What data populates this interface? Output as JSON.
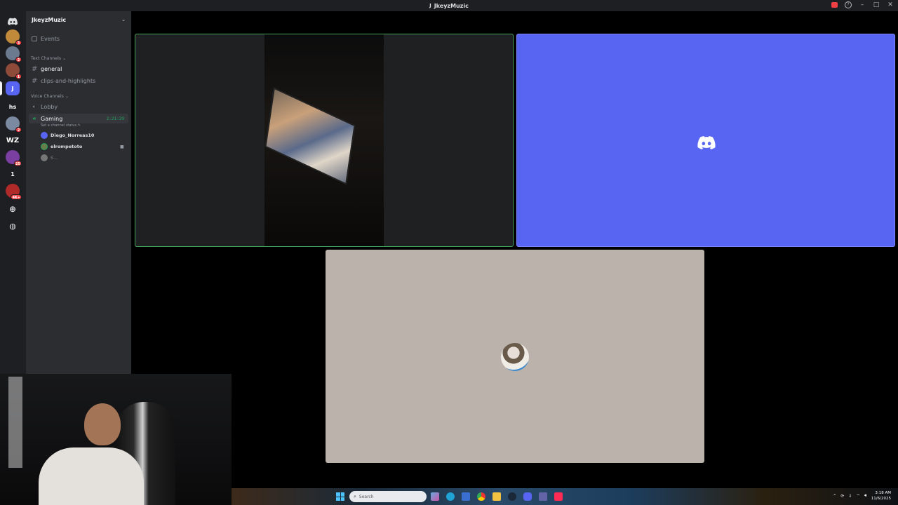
{
  "window": {
    "title": "JkeyzMuzic"
  },
  "server": {
    "name": "JkeyzMuzic"
  },
  "server_rail": {
    "items": [
      {
        "label": "",
        "badge": ""
      },
      {
        "label": "",
        "badge": "3"
      },
      {
        "label": "",
        "badge": "2"
      },
      {
        "label": "",
        "badge": "1"
      },
      {
        "label": "J",
        "badge": ""
      },
      {
        "label": "hs",
        "badge": ""
      },
      {
        "label": "",
        "badge": "2"
      },
      {
        "label": "WZ",
        "badge": ""
      },
      {
        "label": "",
        "badge": "25"
      },
      {
        "label": "1",
        "badge": ""
      },
      {
        "label": "",
        "badge": "4K+"
      }
    ]
  },
  "sidebar": {
    "events_label": "Events",
    "text_category": "Text Channels",
    "text_channels": [
      {
        "name": "general"
      },
      {
        "name": "clips-and-highlights"
      }
    ],
    "voice_category": "Voice Channels",
    "voice_channels": [
      {
        "name": "Lobby"
      },
      {
        "name": "Gaming",
        "timer": "2:21:29",
        "status_hint": "Set a channel status"
      }
    ],
    "members": [
      {
        "name": "Diego_Norreas10"
      },
      {
        "name": "elrompetoto"
      },
      {
        "name": "S..."
      }
    ]
  },
  "taskbar": {
    "search_placeholder": "Search",
    "time": "3:18 AM",
    "date": "11/6/2025"
  },
  "colors": {
    "blurple": "#5865f2",
    "speaking_green": "#43a25a",
    "tile_beige": "#bbb3ab"
  },
  "icons": [
    "discord-logo-icon",
    "search-icon",
    "chevron-down-icon",
    "hash-icon",
    "speaker-icon",
    "camera-icon",
    "windows-start-icon"
  ]
}
